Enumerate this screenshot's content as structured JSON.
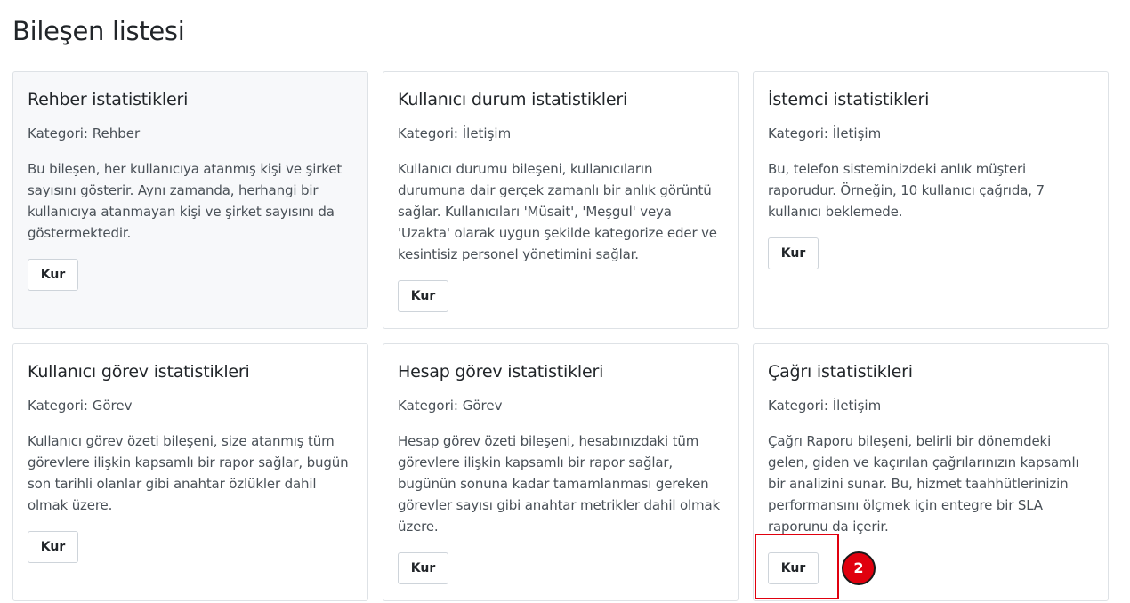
{
  "page": {
    "title": "Bileşen listesi"
  },
  "cards": [
    {
      "title": "Rehber istatistikleri",
      "category": "Kategori: Rehber",
      "description": "Bu bileşen, her kullanıcıya atanmış kişi ve şirket sayısını gösterir. Aynı zamanda, herhangi bir kullanıcıya atanmayan kişi ve şirket sayısını da göstermektedir.",
      "button_label": "Kur"
    },
    {
      "title": "Kullanıcı durum istatistikleri",
      "category": "Kategori: İletişim",
      "description": "Kullanıcı durumu bileşeni, kullanıcıların durumuna dair gerçek zamanlı bir anlık görüntü sağlar. Kullanıcıları 'Müsait', 'Meşgul' veya 'Uzakta' olarak uygun şekilde kategorize eder ve kesintisiz personel yönetimini sağlar.",
      "button_label": "Kur"
    },
    {
      "title": "İstemci istatistikleri",
      "category": "Kategori: İletişim",
      "description": "Bu, telefon sisteminizdeki anlık müşteri raporudur. Örneğin, 10 kullanıcı çağrıda, 7 kullanıcı beklemede.",
      "button_label": "Kur"
    },
    {
      "title": "Kullanıcı görev istatistikleri",
      "category": "Kategori: Görev",
      "description": "Kullanıcı görev özeti bileşeni, size atanmış tüm görevlere ilişkin kapsamlı bir rapor sağlar, bugün son tarihli olanlar gibi anahtar özlükler dahil olmak üzere.",
      "button_label": "Kur"
    },
    {
      "title": "Hesap görev istatistikleri",
      "category": "Kategori: Görev",
      "description": "Hesap görev özeti bileşeni, hesabınızdaki tüm görevlere ilişkin kapsamlı bir rapor sağlar, bugünün sonuna kadar tamamlanması gereken görevler sayısı gibi anahtar metrikler dahil olmak üzere.",
      "button_label": "Kur"
    },
    {
      "title": "Çağrı istatistikleri",
      "category": "Kategori: İletişim",
      "description": "Çağrı Raporu bileşeni, belirli bir dönemdeki gelen, giden ve kaçırılan çağrılarınızın kapsamlı bir analizini sunar. Bu, hizmet taahhütlerinizin performansını ölçmek için entegre bir SLA raporunu da içerir.",
      "button_label": "Kur"
    }
  ],
  "annotation": {
    "step_number": "2",
    "color": "#e0000e"
  }
}
